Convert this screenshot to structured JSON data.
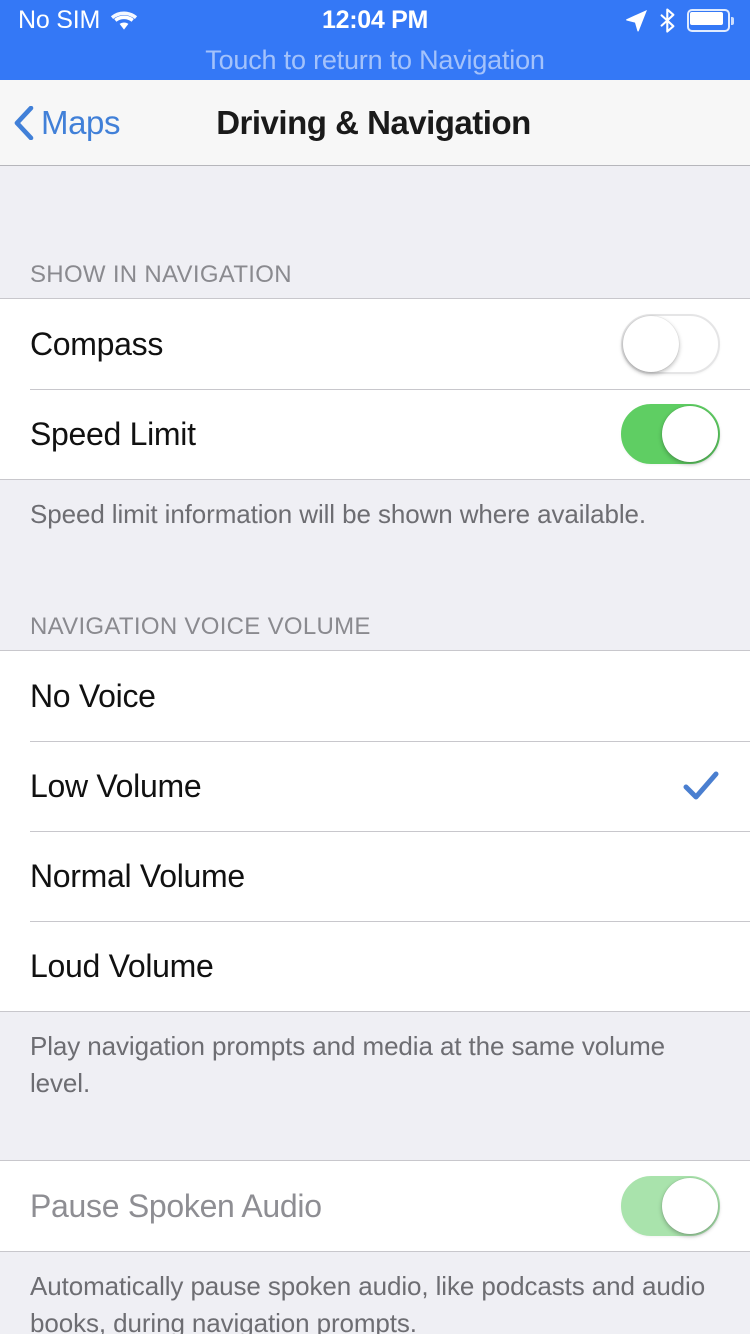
{
  "status_bar": {
    "carrier": "No SIM",
    "time": "12:04 PM",
    "wifi_icon": "wifi-icon",
    "location_icon": "location-arrow-icon",
    "bluetooth_icon": "bluetooth-icon",
    "battery_icon": "battery-icon"
  },
  "banner": {
    "text": "Touch to return to Navigation",
    "background_color": "#3478f6"
  },
  "navbar": {
    "back_label": "Maps",
    "back_icon": "chevron-left-icon",
    "title": "Driving & Navigation",
    "tint_color": "#4180d8"
  },
  "sections": [
    {
      "header": "SHOW IN NAVIGATION",
      "rows": [
        {
          "label": "Compass",
          "control": "switch",
          "on": false,
          "disabled": false
        },
        {
          "label": "Speed Limit",
          "control": "switch",
          "on": true,
          "disabled": false
        }
      ],
      "footer": "Speed limit information will be shown where available."
    },
    {
      "header": "NAVIGATION VOICE VOLUME",
      "rows": [
        {
          "label": "No Voice",
          "control": "check",
          "checked": false
        },
        {
          "label": "Low Volume",
          "control": "check",
          "checked": true
        },
        {
          "label": "Normal Volume",
          "control": "check",
          "checked": false
        },
        {
          "label": "Loud Volume",
          "control": "check",
          "checked": false
        }
      ],
      "footer": "Play navigation prompts and media at the same volume level."
    },
    {
      "header": "",
      "rows": [
        {
          "label": "Pause Spoken Audio",
          "control": "switch",
          "on": true,
          "disabled": true
        }
      ],
      "footer": "Automatically pause spoken audio, like podcasts and audio books, during navigation prompts."
    }
  ],
  "colors": {
    "switch_on_green": "#5fce63",
    "switch_on_green_disabled": "#a9e3ac",
    "checkmark_blue": "#4a7fd0",
    "grouped_background": "#efeff4",
    "cell_background": "#ffffff",
    "separator": "#c8c7cc"
  }
}
